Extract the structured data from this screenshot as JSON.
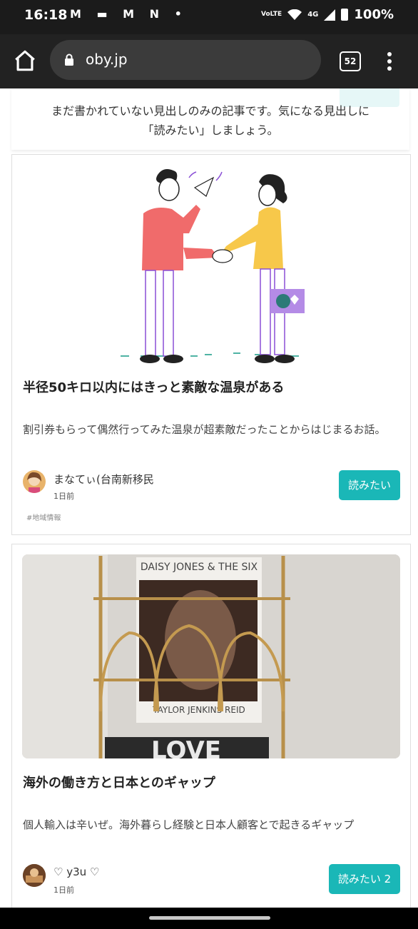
{
  "status_bar": {
    "time": "16:18",
    "notification_icons": "M ▬ M N •",
    "network_label": "VoLTE",
    "signal_label": "4G",
    "battery": "100%"
  },
  "browser": {
    "url": "oby.jp",
    "tab_count": "52"
  },
  "notice": {
    "text_line1": "まだ書かれていない見出しのみの記事です。気になる見出しに",
    "text_line2": "「読みたい」しましょう。"
  },
  "articles": [
    {
      "title": "半径50キロ以内にはきっと素敵な温泉がある",
      "description": "割引券もらって偶然行ってみた温泉が超素敵だったことからはじまるお話。",
      "author": "まなてぃ(台南新移民",
      "time_ago": "1日前",
      "tag": "#地域情報",
      "read_button": "読みたい"
    },
    {
      "title": "海外の働き方と日本とのギャップ",
      "description": "個人輸入は辛いぜ。海外暮らし経験と日本人顧客とで起きるギャップ",
      "author": "♡ y3u ♡",
      "time_ago": "1日前",
      "read_button": "読みたい 2",
      "photo_text_top": "DAISY JONES & THE SIX",
      "photo_text_author": "TAYLOR JENKINS REID",
      "photo_text_bottom": "LOVE"
    }
  ],
  "colors": {
    "accent": "#1ab7b7",
    "status_bar": "#1b1b1b",
    "toolbar": "#222222"
  },
  "icons": [
    "home-icon",
    "lock-icon",
    "tab-switcher-icon",
    "overflow-menu-icon",
    "wifi-icon",
    "signal-icon",
    "battery-icon"
  ]
}
